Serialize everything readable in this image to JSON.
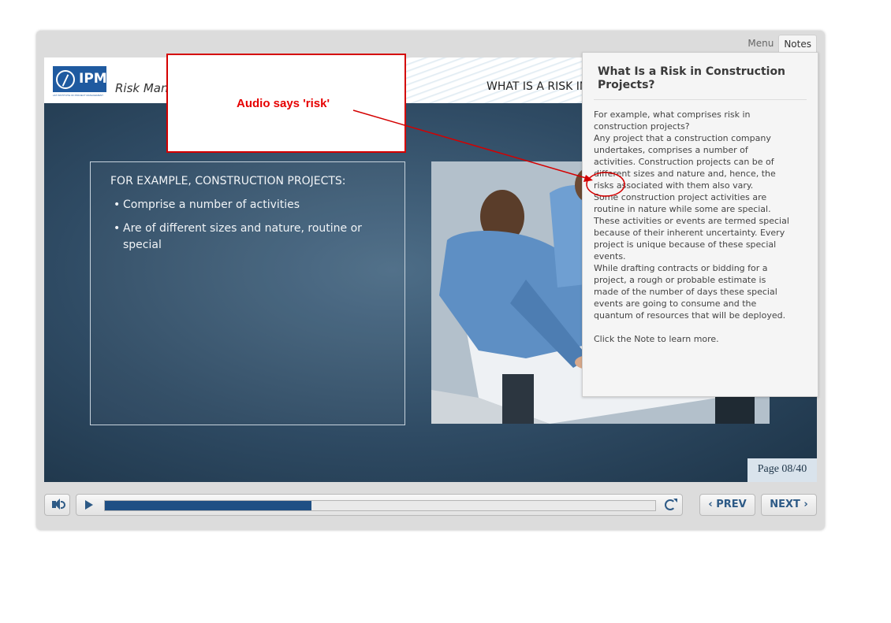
{
  "tabs": {
    "menu": "Menu",
    "notes": "Notes"
  },
  "logo": {
    "text": "IPM",
    "subtext": "L&T INSTITUTE OF PROJECT MANAGEMENT"
  },
  "header": {
    "course_title": "Risk Management",
    "slide_title": "WHAT IS A RISK IN CONSTRUCTION PROJECTS?"
  },
  "content": {
    "heading": "FOR EXAMPLE, CONSTRUCTION PROJECTS:",
    "bullets": [
      "Comprise a number of activities",
      "Are of different sizes and nature, routine or special"
    ]
  },
  "page_counter": "Page 08/40",
  "controls": {
    "progress": 0.375,
    "prev_label": "PREV",
    "next_label": "NEXT"
  },
  "notes": {
    "title": "What Is a Risk in Construction Projects?",
    "paragraphs": [
      "For example, what comprises risk in construction projects?",
      "Any project that a construction company undertakes, comprises a number of activities. Construction projects can be of different sizes and nature and, hence, the risks associated with them also vary.",
      "Some construction project activities are routine in nature while some are special. These activities or events are termed special because of their inherent uncertainty. Every project is unique because of these special events.",
      "While drafting contracts or bidding for a project, a rough or probable estimate is made of the number of days these special events are going to consume and the quantum of resources that will be deployed."
    ],
    "footer": "Click the Note to learn more."
  },
  "annotation": {
    "callout_text": "Audio says 'risk'",
    "color": "#d40000"
  }
}
